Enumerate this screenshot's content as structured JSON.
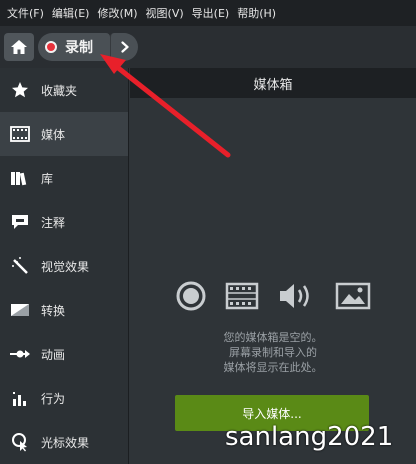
{
  "menubar": {
    "items": [
      {
        "label": "文件(F)"
      },
      {
        "label": "编辑(E)"
      },
      {
        "label": "修改(M)"
      },
      {
        "label": "视图(V)"
      },
      {
        "label": "导出(E)"
      },
      {
        "label": "帮助(H)"
      }
    ]
  },
  "toolbar": {
    "home_icon": "home-icon",
    "record_label": "录制",
    "record_color": "#e8323c",
    "more_icon": "chevron-right-icon"
  },
  "sidebar": {
    "items": [
      {
        "label": "收藏夹",
        "icon": "star-icon"
      },
      {
        "label": "媒体",
        "icon": "film-icon",
        "active": true
      },
      {
        "label": "库",
        "icon": "library-icon"
      },
      {
        "label": "注释",
        "icon": "annotation-icon"
      },
      {
        "label": "视觉效果",
        "icon": "magic-wand-icon"
      },
      {
        "label": "转换",
        "icon": "transition-icon"
      },
      {
        "label": "动画",
        "icon": "animation-icon"
      },
      {
        "label": "行为",
        "icon": "behavior-icon"
      },
      {
        "label": "光标效果",
        "icon": "cursor-icon"
      }
    ]
  },
  "main": {
    "header_title": "媒体箱",
    "empty_line1": "您的媒体箱是空的。",
    "empty_line2": "屏幕录制和导入的",
    "empty_line3": "媒体将显示在此处。",
    "import_label": "导入媒体...",
    "import_color": "#5a8a16"
  },
  "watermark": "sanlang2021",
  "annotation_color": "#e8202a"
}
